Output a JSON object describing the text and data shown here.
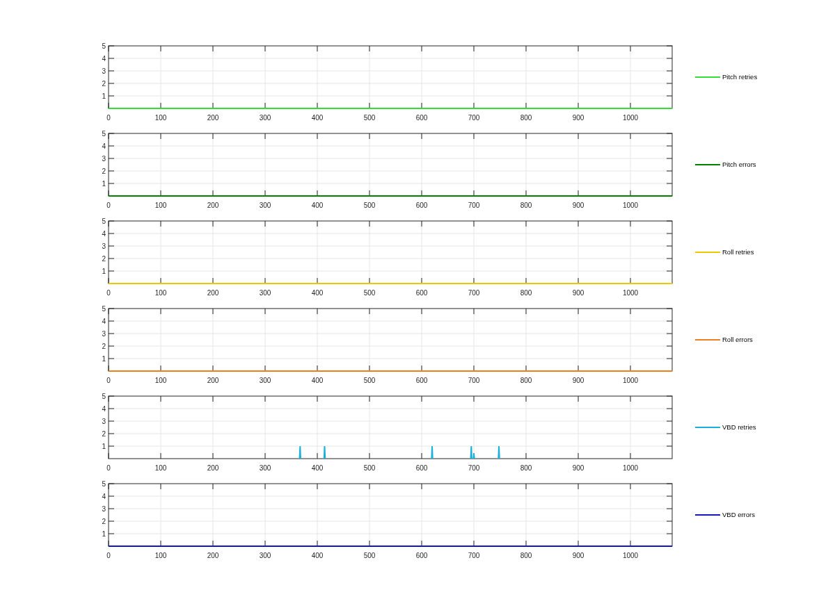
{
  "charts": [
    {
      "chart_data": {
        "type": "line",
        "x": [
          0,
          1080
        ],
        "series": [
          {
            "name": "Pitch retries",
            "color": "#33dd33",
            "values": [
              0,
              0
            ]
          }
        ],
        "xlim": [
          0,
          1080
        ],
        "ylim": [
          0,
          5
        ],
        "xticks": [
          0,
          100,
          200,
          300,
          400,
          500,
          600,
          700,
          800,
          900,
          1000
        ],
        "yticks": [
          1,
          2,
          3,
          4,
          5
        ],
        "grid": true
      }
    },
    {
      "chart_data": {
        "type": "line",
        "x": [
          0,
          1080
        ],
        "series": [
          {
            "name": "Pitch errors",
            "color": "#008000",
            "values": [
              0,
              0
            ]
          }
        ],
        "xlim": [
          0,
          1080
        ],
        "ylim": [
          0,
          5
        ],
        "xticks": [
          0,
          100,
          200,
          300,
          400,
          500,
          600,
          700,
          800,
          900,
          1000
        ],
        "yticks": [
          1,
          2,
          3,
          4,
          5
        ],
        "grid": true
      }
    },
    {
      "chart_data": {
        "type": "line",
        "x": [
          0,
          1080
        ],
        "series": [
          {
            "name": "Roll retries",
            "color": "#f0c800",
            "values": [
              0,
              0
            ]
          }
        ],
        "xlim": [
          0,
          1080
        ],
        "ylim": [
          0,
          5
        ],
        "xticks": [
          0,
          100,
          200,
          300,
          400,
          500,
          600,
          700,
          800,
          900,
          1000
        ],
        "yticks": [
          1,
          2,
          3,
          4,
          5
        ],
        "grid": true
      }
    },
    {
      "chart_data": {
        "type": "line",
        "x": [
          0,
          1080
        ],
        "series": [
          {
            "name": "Roll errors",
            "color": "#ee7f1e",
            "values": [
              0,
              0
            ]
          }
        ],
        "xlim": [
          0,
          1080
        ],
        "ylim": [
          0,
          5
        ],
        "xticks": [
          0,
          100,
          200,
          300,
          400,
          500,
          600,
          700,
          800,
          900,
          1000
        ],
        "yticks": [
          1,
          2,
          3,
          4,
          5
        ],
        "grid": true
      }
    },
    {
      "chart_data": {
        "type": "line",
        "x": [
          366,
          367,
          368,
          390,
          413,
          414,
          415,
          500,
          619,
          620,
          621,
          650,
          694,
          695,
          696,
          697,
          699,
          700,
          701,
          720,
          747,
          748,
          749
        ],
        "series": [
          {
            "name": "VBD retries",
            "color": "#1eb0dc",
            "values": [
              0,
              1,
              0,
              null,
              0,
              1,
              0,
              null,
              0,
              1,
              0,
              null,
              0,
              1,
              0,
              null,
              0,
              0.4,
              0,
              null,
              0,
              1,
              0
            ]
          }
        ],
        "xlim": [
          0,
          1080
        ],
        "ylim": [
          0,
          5
        ],
        "xticks": [
          0,
          100,
          200,
          300,
          400,
          500,
          600,
          700,
          800,
          900,
          1000
        ],
        "yticks": [
          1,
          2,
          3,
          4,
          5
        ],
        "grid": true
      }
    },
    {
      "chart_data": {
        "type": "line",
        "x": [
          0,
          1080
        ],
        "series": [
          {
            "name": "VBD errors",
            "color": "#1515c0",
            "values": [
              0,
              0
            ]
          }
        ],
        "xlim": [
          0,
          1080
        ],
        "ylim": [
          0,
          5
        ],
        "xticks": [
          0,
          100,
          200,
          300,
          400,
          500,
          600,
          700,
          800,
          900,
          1000
        ],
        "yticks": [
          1,
          2,
          3,
          4,
          5
        ],
        "grid": true
      }
    }
  ]
}
